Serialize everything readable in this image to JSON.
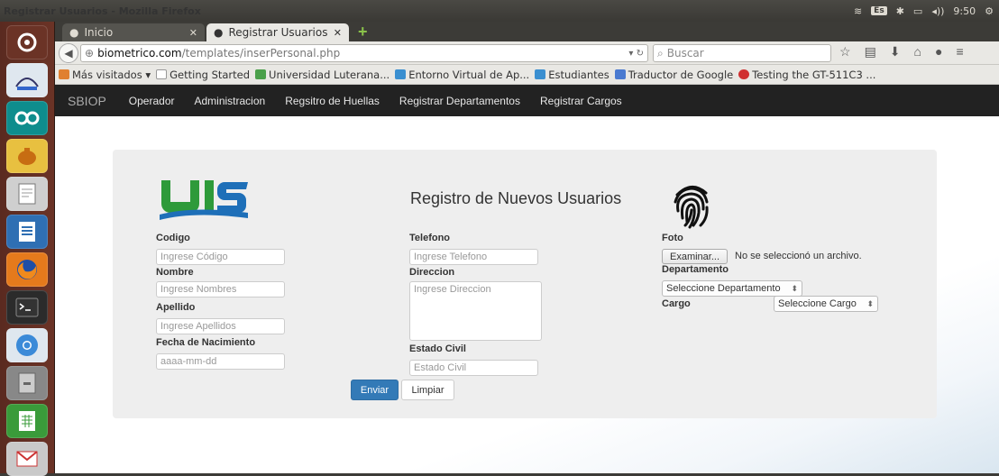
{
  "window": {
    "title": "Registrar Usuarios - Mozilla Firefox"
  },
  "system": {
    "keyboard": "Es",
    "time": "9:50"
  },
  "tabs": [
    {
      "label": "Inicio"
    },
    {
      "label": "Registrar Usuarios"
    }
  ],
  "url": {
    "host": "biometrico.com",
    "path": "/templates/inserPersonal.php"
  },
  "search": {
    "placeholder": "Buscar"
  },
  "bookmarks": [
    {
      "label": "Más visitados ▾",
      "icon": "folder-icon",
      "color": "#e08030"
    },
    {
      "label": "Getting Started",
      "icon": "page-icon",
      "color": "#dddddd"
    },
    {
      "label": "Universidad Luterana...",
      "icon": "uls-icon",
      "color": "#4aa04a"
    },
    {
      "label": "Entorno Virtual de Ap...",
      "icon": "uls-icon",
      "color": "#3a8fd0"
    },
    {
      "label": "Estudiantes",
      "icon": "uls-icon",
      "color": "#3a8fd0"
    },
    {
      "label": "Traductor de Google",
      "icon": "translate-icon",
      "color": "#4a7ad0"
    },
    {
      "label": "Testing the GT-511C3 ...",
      "icon": "testing-icon",
      "color": "#d03030"
    }
  ],
  "site_nav": {
    "brand": "SBIOP",
    "links": [
      "Operador",
      "Administracion",
      "Regsitro de Huellas",
      "Registrar Departamentos",
      "Registrar Cargos"
    ]
  },
  "form": {
    "title": "Registro de Nuevos Usuarios",
    "logo_text": "ULS",
    "codigo": {
      "label": "Codigo",
      "placeholder": "Ingrese Código"
    },
    "nombre": {
      "label": "Nombre",
      "placeholder": "Ingrese Nombres"
    },
    "apellido": {
      "label": "Apellido",
      "placeholder": "Ingrese Apellidos"
    },
    "fecha": {
      "label": "Fecha de Nacimiento",
      "placeholder": "aaaa-mm-dd"
    },
    "telefono": {
      "label": "Telefono",
      "placeholder": "Ingrese Telefono"
    },
    "direccion": {
      "label": "Direccion",
      "placeholder": "Ingrese Direccion"
    },
    "estado_civil": {
      "label": "Estado Civil",
      "placeholder": "Estado Civil"
    },
    "foto": {
      "label": "Foto",
      "button": "Examinar...",
      "status": "No se seleccionó un archivo."
    },
    "departamento": {
      "label": "Departamento",
      "selected": "Seleccione Departamento"
    },
    "cargo": {
      "label": "Cargo",
      "selected": "Seleccione Cargo"
    },
    "submit": "Enviar",
    "reset": "Limpiar"
  },
  "colors": {
    "primary": "#337ab7",
    "navbar": "#222222",
    "logo_green": "#2e9a3a",
    "logo_blue": "#1e6fb8"
  }
}
